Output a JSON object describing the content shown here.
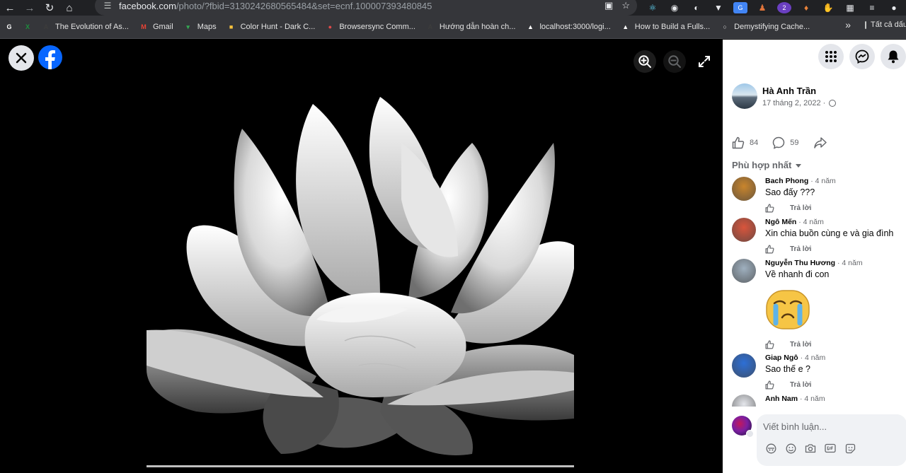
{
  "browser": {
    "url_host": "facebook.com",
    "url_path": "/photo/?fbid=3130242680565484&set=ecnf.100007393480845",
    "bookmarks": [
      {
        "label": "",
        "icon": "google-icon",
        "color": "#ffffff"
      },
      {
        "label": "",
        "icon": "sheets-icon",
        "color": "#1e8e3e"
      },
      {
        "label": "The Evolution of As...",
        "icon": "angular-icon",
        "color": "#3c3c3c"
      },
      {
        "label": "Gmail",
        "icon": "gmail-icon",
        "color": "#ea4335"
      },
      {
        "label": "Maps",
        "icon": "maps-icon",
        "color": "#34a853"
      },
      {
        "label": "Color Hunt - Dark C...",
        "icon": "colorhunt-icon",
        "color": "#f9c23c"
      },
      {
        "label": "Browsersync Comm...",
        "icon": "browsersync-icon",
        "color": "#e04a4a"
      },
      {
        "label": "Hướng dẫn hoàn ch...",
        "icon": "angular-icon",
        "color": "#3c3c3c"
      },
      {
        "label": "localhost:3000/logi...",
        "icon": "triangle-icon",
        "color": "#ffffff"
      },
      {
        "label": "How to Build a Fulls...",
        "icon": "triangle-icon",
        "color": "#ffffff"
      },
      {
        "label": "Demystifying Cache...",
        "icon": "site-icon",
        "color": "#d9d9d9"
      }
    ],
    "bookmarks_folder": "Tất cả dấu trang"
  },
  "post": {
    "author": "Hà Anh Trần",
    "date": "17 tháng 2, 2022 ·",
    "likes": "84",
    "comments_count": "59",
    "sort_label": "Phù hợp nhất"
  },
  "comments": [
    {
      "name": "Bach Phong",
      "time": "· 4 năm",
      "text": "Sao đấy ???",
      "reply": "Trả lời",
      "avatar": "#c9852c"
    },
    {
      "name": "Ngô Mến",
      "time": "· 4 năm",
      "text": "Xin chia buồn cùng e và gia đình",
      "reply": "Trả lời",
      "avatar": "#d9553c"
    },
    {
      "name": "Nguyễn Thu Hương",
      "time": "· 4 năm",
      "text": "Về nhanh đi con",
      "reply": "Trả lời",
      "avatar": "#9fb0bf"
    },
    {
      "name": "Giap Ngô",
      "time": "· 4 năm",
      "text": "Sao thế e ?",
      "reply": "Trả lời",
      "avatar": "#2d6fd6"
    },
    {
      "name": "Anh Nam",
      "time": "· 4 năm",
      "text": "",
      "reply": "",
      "avatar": "#e4e6eb"
    }
  ],
  "composer": {
    "placeholder": "Viết bình luận..."
  }
}
